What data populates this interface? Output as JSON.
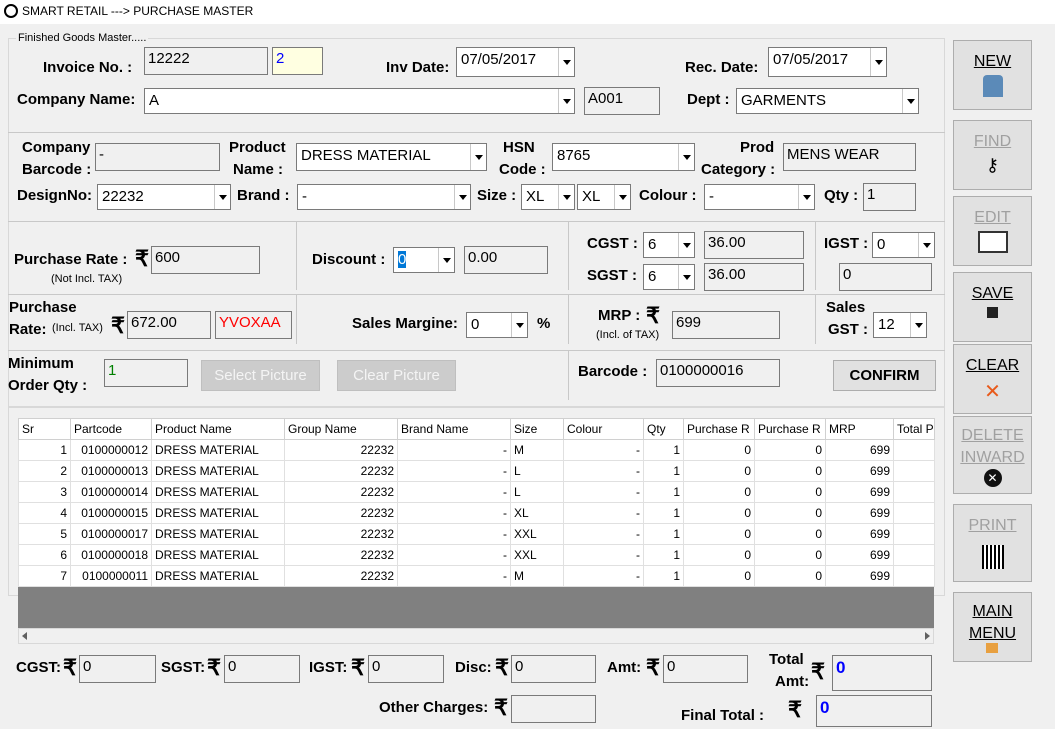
{
  "window": {
    "title": "SMART RETAIL ---> PURCHASE MASTER"
  },
  "group_label": "Finished Goods Master.....",
  "header": {
    "invoice_label": "Invoice No. :",
    "invoice_no": "12222",
    "invoice_seq": "2",
    "inv_date_label": "Inv Date:",
    "inv_date": "07/05/2017",
    "rec_date_label": "Rec. Date:",
    "rec_date": "07/05/2017",
    "company_label": "Company Name:",
    "company_name": "A",
    "company_code": "A001",
    "dept_label": "Dept :",
    "dept": "GARMENTS"
  },
  "product": {
    "company_barcode_label1": "Company",
    "company_barcode_label2": "Barcode :",
    "company_barcode": "-",
    "product_name_label1": "Product",
    "product_name_label2": "Name :",
    "product_name": "DRESS MATERIAL",
    "hsn_label1": "HSN",
    "hsn_label2": "Code :",
    "hsn_code": "8765",
    "prod_category_label1": "Prod",
    "prod_category_label2": "Category :",
    "prod_category": "MENS WEAR",
    "design_label": "DesignNo:",
    "design_no": "22232",
    "brand_label": "Brand :",
    "brand": "-",
    "size_label": "Size :",
    "size1": "XL",
    "size2": "XL",
    "colour_label": "Colour :",
    "colour": "-",
    "qty_label": "Qty :",
    "qty": "1"
  },
  "pricing": {
    "purchase_rate_label": "Purchase Rate :",
    "purchase_rate_note": "(Not Incl. TAX)",
    "purchase_rate": "600",
    "discount_label": "Discount :",
    "discount_pct": "0",
    "discount_amt": "0.00",
    "cgst_label": "CGST :",
    "cgst_rate": "6",
    "cgst_amt": "36.00",
    "sgst_label": "SGST :",
    "sgst_rate": "6",
    "sgst_amt": "36.00",
    "igst_label": "IGST :",
    "igst_rate": "0",
    "igst_amt": "0",
    "purchase_rate_incl_label1": "Purchase",
    "purchase_rate_incl_label2": "Rate:",
    "purchase_rate_incl_note": "(Incl. TAX)",
    "purchase_rate_incl": "672.00",
    "rate_code": "YVOXAA",
    "sales_margin_label": "Sales Margine:",
    "sales_margin": "0",
    "percent": "%",
    "mrp_label": "MRP :",
    "mrp_note": "(Incl. of TAX)",
    "mrp": "699",
    "sales_gst_label1": "Sales",
    "sales_gst_label2": "GST :",
    "sales_gst": "12",
    "min_order_label1": "Minimum",
    "min_order_label2": "Order Qty :",
    "min_order_qty": "1",
    "select_picture": "Select Picture",
    "clear_picture": "Clear Picture",
    "barcode_label": "Barcode :",
    "barcode": "0100000016",
    "confirm": "CONFIRM"
  },
  "grid": {
    "columns": [
      "Sr",
      "Partcode",
      "Product Name",
      "Group Name",
      "Brand Name",
      "Size",
      "Colour",
      "Qty",
      "Purchase R",
      "Purchase R",
      "MRP",
      "Total P"
    ],
    "rows": [
      [
        "1",
        "0100000012",
        "DRESS MATERIAL",
        "22232",
        "-",
        "M",
        "-",
        "1",
        "0",
        "0",
        "699",
        ""
      ],
      [
        "2",
        "0100000013",
        "DRESS MATERIAL",
        "22232",
        "-",
        "L",
        "-",
        "1",
        "0",
        "0",
        "699",
        ""
      ],
      [
        "3",
        "0100000014",
        "DRESS MATERIAL",
        "22232",
        "-",
        "L",
        "-",
        "1",
        "0",
        "0",
        "699",
        ""
      ],
      [
        "4",
        "0100000015",
        "DRESS MATERIAL",
        "22232",
        "-",
        "XL",
        "-",
        "1",
        "0",
        "0",
        "699",
        ""
      ],
      [
        "5",
        "0100000017",
        "DRESS MATERIAL",
        "22232",
        "-",
        "XXL",
        "-",
        "1",
        "0",
        "0",
        "699",
        ""
      ],
      [
        "6",
        "0100000018",
        "DRESS MATERIAL",
        "22232",
        "-",
        "XXL",
        "-",
        "1",
        "0",
        "0",
        "699",
        ""
      ],
      [
        "7",
        "0100000011",
        "DRESS MATERIAL",
        "22232",
        "-",
        "M",
        "-",
        "1",
        "0",
        "0",
        "699",
        ""
      ]
    ]
  },
  "totals": {
    "cgst_label": "CGST:",
    "cgst": "0",
    "sgst_label": "SGST:",
    "sgst": "0",
    "igst_label": "IGST:",
    "igst": "0",
    "disc_label": "Disc:",
    "disc": "0",
    "amt_label": "Amt:",
    "amt": "0",
    "total_label1": "Total",
    "total_label2": "Amt:",
    "total_amt": "0",
    "other_label": "Other Charges:",
    "other": "",
    "final_label": "Final Total :",
    "final_total": "0",
    "rupee": "₹"
  },
  "sidebar": {
    "new": "NEW",
    "find": "FIND",
    "edit": "EDIT",
    "save": "SAVE",
    "clear": "CLEAR",
    "delete1": "DELETE",
    "delete2": "INWARD",
    "print": "PRINT",
    "main1": "MAIN",
    "main2": "MENU"
  },
  "colors": {
    "seq_bg": "#ffffe1",
    "seq_text": "#0000ff",
    "code_red": "#ff0000",
    "green": "#008000",
    "blue": "#0000ff",
    "clear_x": "#e85a1b",
    "grid_empty": "#808080"
  }
}
